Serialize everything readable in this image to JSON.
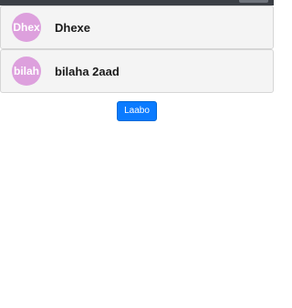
{
  "list": {
    "items": [
      {
        "avatar_text": "Dhex",
        "label": "Dhexe"
      },
      {
        "avatar_text": "bilah",
        "label": "bilaha 2aad"
      }
    ]
  },
  "actions": {
    "primary_label": "Laabo"
  },
  "colors": {
    "avatar_bg": "#dda0dd",
    "primary_button": "#0a7bff",
    "item_bg": "#f4f4f4"
  }
}
